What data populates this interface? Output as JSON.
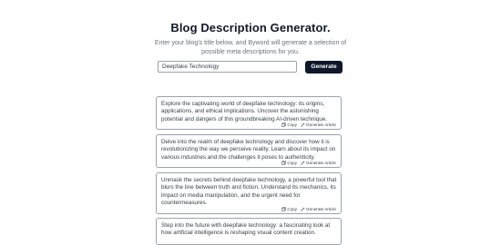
{
  "header": {
    "title": "Blog Description Generator.",
    "subtitle": "Enter your blog's title below, and Byword will generate a selection of possible meta descriptions for you."
  },
  "search": {
    "value": "Deepfake Technology",
    "button_label": "Generate"
  },
  "actions": {
    "copy": "Copy",
    "generate_article": "Generate Article"
  },
  "results": [
    {
      "text": "Explore the captivating world of deepfake technology: its origins, applications, and ethical implications. Uncover the astonishing potential and dangers of this groundbreaking AI-driven technique."
    },
    {
      "text": "Delve into the realm of deepfake technology and discover how it is revolutionizing the way we perceive reality. Learn about its impact on various industries and the challenges it poses to authenticity."
    },
    {
      "text": "Unmask the secrets behind deepfake technology, a powerful tool that blurs the line between truth and fiction. Understand its mechanics, its impact on media manipulation, and the urgent need for countermeasures."
    },
    {
      "text": "Step into the future with deepfake technology: a fascinating look at how artificial intelligence is reshaping visual content creation."
    }
  ]
}
